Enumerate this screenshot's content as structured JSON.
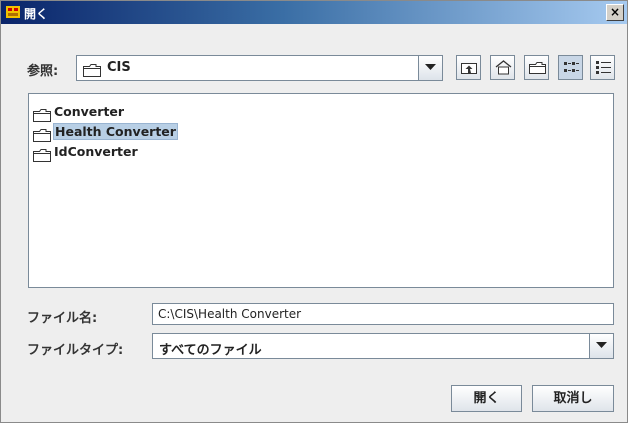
{
  "window": {
    "title": "開く",
    "close_glyph": "×"
  },
  "lookin": {
    "label": "参照:",
    "value": "CIS"
  },
  "toolbar": [
    {
      "name": "up-one-level-icon"
    },
    {
      "name": "home-icon"
    },
    {
      "name": "new-folder-icon"
    },
    {
      "name": "list-view-icon",
      "selected": true
    },
    {
      "name": "details-view-icon"
    }
  ],
  "files": [
    {
      "name": "Converter",
      "selected": false
    },
    {
      "name": "Health Converter",
      "selected": true
    },
    {
      "name": "IdConverter",
      "selected": false
    }
  ],
  "filename": {
    "label": "ファイル名:",
    "value": "C:\\CIS\\Health Converter"
  },
  "filetype": {
    "label": "ファイルタイプ:",
    "value": "すべてのファイル"
  },
  "buttons": {
    "open": "開く",
    "cancel": "取消し"
  },
  "colors": {
    "selection": "#b8cfe5",
    "titlebar": "#0a246a"
  }
}
